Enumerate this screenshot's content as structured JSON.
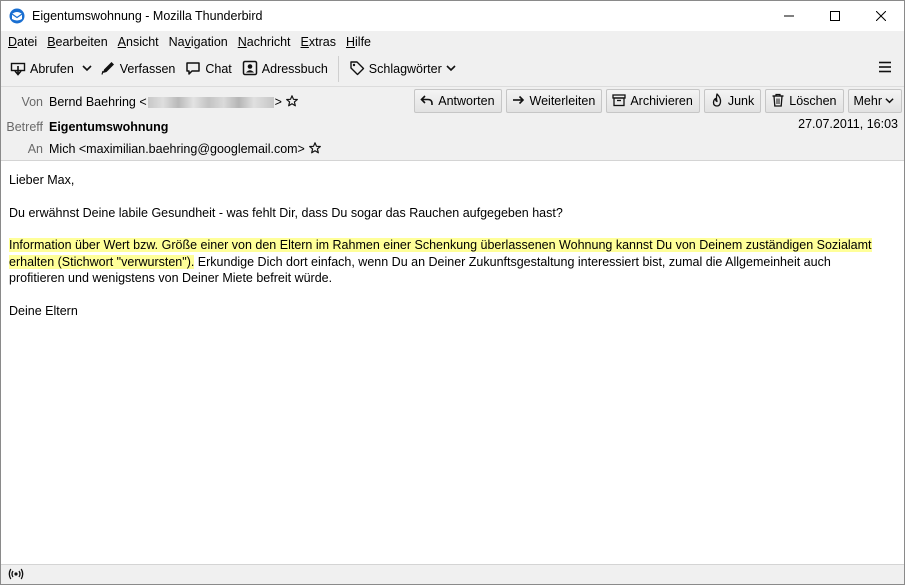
{
  "window": {
    "title": "Eigentumswohnung - Mozilla Thunderbird"
  },
  "menu": {
    "items": [
      {
        "label": "Datei",
        "accel": "D",
        "rest": "atei"
      },
      {
        "label": "Bearbeiten",
        "accel": "B",
        "rest": "earbeiten"
      },
      {
        "label": "Ansicht",
        "accel": "A",
        "rest": "nsicht"
      },
      {
        "label": "Navigation",
        "accel": "",
        "pre": "Na",
        "mid": "v",
        "post": "igation"
      },
      {
        "label": "Nachricht",
        "accel": "N",
        "rest": "achricht"
      },
      {
        "label": "Extras",
        "accel": "E",
        "rest": "xtras"
      },
      {
        "label": "Hilfe",
        "accel": "H",
        "rest": "ilfe"
      }
    ]
  },
  "toolbar": {
    "get_mail": "Abrufen",
    "write": "Verfassen",
    "chat": "Chat",
    "address_book": "Adressbuch",
    "tags": "Schlagwörter"
  },
  "header": {
    "from_label": "Von",
    "from_name": "Bernd Baehring <",
    "from_close": ">",
    "subject_label": "Betreff",
    "subject": "Eigentumswohnung",
    "to_label": "An",
    "to": "Mich <maximilian.baehring@googlemail.com>",
    "date": "27.07.2011, 16:03",
    "actions": {
      "reply": "Antworten",
      "forward": "Weiterleiten",
      "archive": "Archivieren",
      "junk": "Junk",
      "delete": "Löschen",
      "more": "Mehr"
    }
  },
  "body": {
    "greeting": "Lieber Max,",
    "question": "Du erwähnst Deine labile Gesundheit - was fehlt Dir, dass Du sogar das Rauchen aufgegeben hast?",
    "highlighted_line1": "Information über Wert bzw. Größe einer von den Eltern im Rahmen einer Schenkung überlassenen Wohnung kannst Du von Deinem zuständigen Sozialamt",
    "highlighted_line2": "erhalten (Stichwort \"verwursten\").",
    "rest_line2": " Erkundige Dich dort einfach, wenn Du an Deiner Zukunftsgestaltung interessiert bist, zumal die Allgemeinheit auch",
    "rest_line3": "profitieren und wenigstens von Deiner Miete befreit würde.",
    "signature": "Deine Eltern"
  },
  "colors": {
    "highlight": "#ffff99",
    "chrome": "#f0f0f0",
    "thunderbird_blue": "#1a6fd1"
  }
}
